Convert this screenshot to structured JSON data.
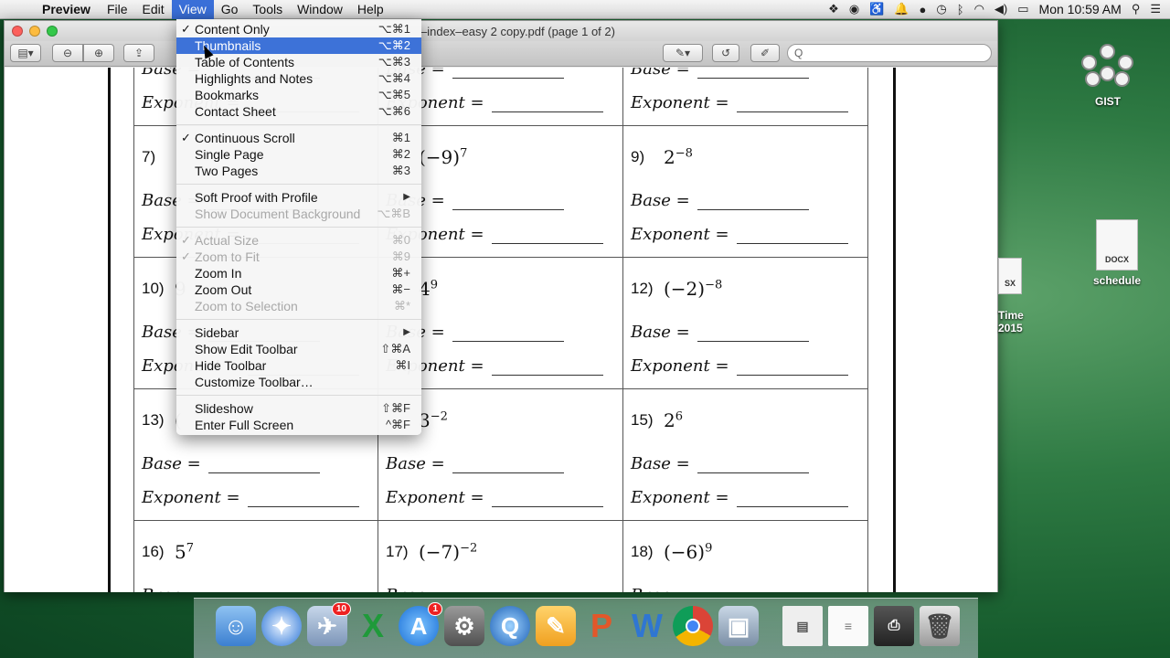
{
  "menubar": {
    "apple_icon": "apple-icon",
    "app_name": "Preview",
    "menus": [
      "File",
      "Edit",
      "View",
      "Go",
      "Tools",
      "Window",
      "Help"
    ],
    "active_menu": "View",
    "clock": "Mon 10:59 AM"
  },
  "window": {
    "title": "–index–easy 2 copy.pdf (page 1 of 2)",
    "search_placeholder": "Q"
  },
  "view_menu": {
    "group1": [
      {
        "label": "Content Only",
        "shortcut": "⌥⌘1",
        "checked": "✓"
      },
      {
        "label": "Thumbnails",
        "shortcut": "⌥⌘2",
        "checked": ""
      },
      {
        "label": "Table of Contents",
        "shortcut": "⌥⌘3",
        "checked": ""
      },
      {
        "label": "Highlights and Notes",
        "shortcut": "⌥⌘4",
        "checked": ""
      },
      {
        "label": "Bookmarks",
        "shortcut": "⌥⌘5",
        "checked": ""
      },
      {
        "label": "Contact Sheet",
        "shortcut": "⌥⌘6",
        "checked": ""
      }
    ],
    "group2": [
      {
        "label": "Continuous Scroll",
        "shortcut": "⌘1",
        "checked": "✓"
      },
      {
        "label": "Single Page",
        "shortcut": "⌘2",
        "checked": ""
      },
      {
        "label": "Two Pages",
        "shortcut": "⌘3",
        "checked": ""
      }
    ],
    "group3": [
      {
        "label": "Soft Proof with Profile",
        "shortcut": "▶"
      },
      {
        "label": "Show Document Background",
        "shortcut": "⌥⌘B"
      }
    ],
    "group4": [
      {
        "label": "Actual Size",
        "shortcut": "⌘0",
        "checked": "✓"
      },
      {
        "label": "Zoom to Fit",
        "shortcut": "⌘9",
        "checked": "✓"
      },
      {
        "label": "Zoom In",
        "shortcut": "⌘+",
        "checked": ""
      },
      {
        "label": "Zoom Out",
        "shortcut": "⌘−",
        "checked": ""
      },
      {
        "label": "Zoom to Selection",
        "shortcut": "⌘*",
        "checked": ""
      }
    ],
    "group5": [
      {
        "label": "Sidebar",
        "shortcut": "▶"
      },
      {
        "label": "Show Edit Toolbar",
        "shortcut": "⇧⌘A"
      },
      {
        "label": "Hide Toolbar",
        "shortcut": "⌘I"
      },
      {
        "label": "Customize Toolbar…",
        "shortcut": ""
      }
    ],
    "group6": [
      {
        "label": "Slideshow",
        "shortcut": "⇧⌘F"
      },
      {
        "label": "Enter Full Screen",
        "shortcut": "^⌘F"
      }
    ]
  },
  "worksheet": {
    "base_label": "Base =",
    "exponent_label": "Exponent =",
    "problems": [
      {
        "num": "",
        "base": "",
        "exp": ""
      },
      {
        "num": "",
        "base": "",
        "exp": ""
      },
      {
        "num": "",
        "base": "",
        "exp": ""
      },
      {
        "num": "7)",
        "base": "",
        "exp": ""
      },
      {
        "num": "",
        "base": "(−9)",
        "exp": "7"
      },
      {
        "num": "9)",
        "base": "2",
        "exp": "−8"
      },
      {
        "num": "10)",
        "base": "9",
        "exp": ""
      },
      {
        "num": "",
        "base": "4",
        "exp": "9"
      },
      {
        "num": "12)",
        "base": "(−2)",
        "exp": "−8"
      },
      {
        "num": "13)",
        "base": "(",
        "exp": ""
      },
      {
        "num": "",
        "base": "3",
        "exp": "−2"
      },
      {
        "num": "15)",
        "base": "2",
        "exp": "6"
      },
      {
        "num": "16)",
        "base": "5",
        "exp": "7"
      },
      {
        "num": "17)",
        "base": "(−7)",
        "exp": "−2"
      },
      {
        "num": "18)",
        "base": "(−6)",
        "exp": "9"
      }
    ]
  },
  "desktop": {
    "gist_label": "GIST",
    "schedule_label": "schedule",
    "docx_badge": "DOCX",
    "partial_label_1": "Time",
    "partial_label_2": "2015",
    "partial_badge": "SX"
  },
  "dock": {
    "mail_badge": "10",
    "appstore_badge": "1",
    "icons": [
      "finder-icon",
      "safari-icon",
      "mail-icon",
      "excel-icon",
      "app-store-icon",
      "system-preferences-icon",
      "quicktime-icon",
      "pages-icon",
      "powerpoint-icon",
      "word-icon",
      "chrome-icon",
      "preview-icon",
      "minimized-window-icon",
      "document-icon",
      "printer-icon",
      "trash-icon"
    ]
  }
}
